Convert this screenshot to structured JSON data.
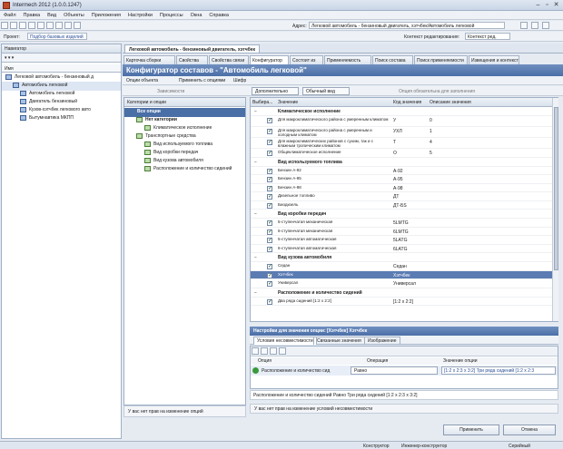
{
  "window": {
    "title": "Intermech 2012 (1.0.0.1247)"
  },
  "menu": [
    "Файл",
    "Правка",
    "Вид",
    "Объекты",
    "Приложения",
    "Настройки",
    "Процессы",
    "Окна",
    "Справка"
  ],
  "toolbar": {
    "address_label": "Адрес:",
    "address_value": "Легковой автомобиль - бензиновый двигатель, хэтчбек/Автомобиль легковой",
    "project_label": "Проект:",
    "project_value": "Подбор базовых изделий",
    "context_label": "Контекст редактирования:",
    "context_value": "Контекст ред."
  },
  "left": {
    "nav_label": "Навигатор",
    "col_name": "Имя",
    "tree": [
      {
        "label": "Легковой автомобиль - бензиновый д",
        "level": 0
      },
      {
        "label": "Автомобиль легковой",
        "level": 1
      },
      {
        "label": "Автомобиль легковой",
        "level": 2
      },
      {
        "label": "Двигатель бензиновый",
        "level": 2
      },
      {
        "label": "Кузов-хэтчбек легкового авто",
        "level": 2
      },
      {
        "label": "Бытумнавтика МКПП",
        "level": 2
      }
    ]
  },
  "doc_tab": "Легковой автомобиль - бензиновый двигатель, хэтчбек",
  "tabs": [
    "Карточка сборки",
    "Свойства",
    "Свойства связи",
    "Конфигуратор",
    "Состоит из",
    "Применяемость",
    "Поиск состава",
    "Поиск применяемости",
    "Извещения и контекст"
  ],
  "configurator": {
    "title": "Конфигуратор составов - \"Автомобиль легковой\"",
    "btn_objects": "Опции объекта",
    "btn_apply": "Применить с опциями",
    "btn_cipher": "Шифр",
    "btn_dependent": "Зависимости",
    "btn_additional": "Дополнительно",
    "btn_view": "Обычный вид",
    "mandatory_hint": "Опция обязательна для заполнения",
    "cat_header": "Категории и опции",
    "cat_tree": [
      {
        "label": "Все опции",
        "level": 0,
        "selected": true
      },
      {
        "label": "Нет категории",
        "level": 1,
        "bold": true
      },
      {
        "label": "Климатическое исполнение",
        "level": 2
      },
      {
        "label": "Транспортные средства",
        "level": 1
      },
      {
        "label": "Вид используемого топлива",
        "level": 2
      },
      {
        "label": "Вид коробки передач",
        "level": 2
      },
      {
        "label": "Вид кузова автомобиля",
        "level": 2
      },
      {
        "label": "Расположение и количество сидений",
        "level": 2
      }
    ],
    "grid_headers": [
      "Выбира...",
      "Значение",
      "Код значения",
      "Описание значения"
    ],
    "grid_rows": [
      {
        "type": "group",
        "value": "Климатическое исполнение"
      },
      {
        "type": "row",
        "checked": true,
        "value": "Для макроклиматического района с умеренным климатом",
        "code": "У",
        "desc": "0"
      },
      {
        "type": "row",
        "checked": true,
        "value": "Для макроклиматического района с умеренным и холодным климатом",
        "code": "УХЛ",
        "desc": "1"
      },
      {
        "type": "row",
        "checked": true,
        "value": "Для макроклиматических районов с сухим, так и с влажным тропическим климатом",
        "code": "Т",
        "desc": "4"
      },
      {
        "type": "row",
        "checked": true,
        "value": "Общеклиматическое исполнение",
        "code": "О",
        "desc": "5"
      },
      {
        "type": "group",
        "value": "Вид используемого топлива"
      },
      {
        "type": "row",
        "checked": true,
        "value": "Бензин А-92",
        "code": "А-92",
        "desc": ""
      },
      {
        "type": "row",
        "checked": true,
        "value": "Бензин А-95",
        "code": "А-95",
        "desc": ""
      },
      {
        "type": "row",
        "checked": true,
        "value": "Бензин А-98",
        "code": "А-98",
        "desc": ""
      },
      {
        "type": "row",
        "checked": true,
        "value": "Дизельное топливо",
        "code": "ДТ",
        "desc": ""
      },
      {
        "type": "row",
        "checked": true,
        "value": "Биодизель",
        "code": "ДТ-БS",
        "desc": ""
      },
      {
        "type": "group",
        "value": "Вид коробки передач"
      },
      {
        "type": "row",
        "checked": true,
        "value": "5-ступенчатая механическая",
        "code": "5LMTG",
        "desc": ""
      },
      {
        "type": "row",
        "checked": true,
        "value": "6-ступенчатая механическая",
        "code": "6LMTG",
        "desc": ""
      },
      {
        "type": "row",
        "checked": true,
        "value": "5-ступенчатая автоматическая",
        "code": "5LATG",
        "desc": ""
      },
      {
        "type": "row",
        "checked": true,
        "value": "6-ступенчатая автоматическая",
        "code": "6LATG",
        "desc": ""
      },
      {
        "type": "group",
        "value": "Вид кузова автомобиля"
      },
      {
        "type": "row",
        "checked": true,
        "value": "Седан",
        "code": "Седан",
        "desc": ""
      },
      {
        "type": "row",
        "checked": true,
        "value": "Хэтчбек",
        "code": "Хэтчбек",
        "desc": "",
        "selected": true
      },
      {
        "type": "row",
        "checked": true,
        "value": "Универсал",
        "code": "Универсал",
        "desc": ""
      },
      {
        "type": "group",
        "value": "Расположение и количество сидений"
      },
      {
        "type": "row",
        "checked": true,
        "value": "Два ряда сидений [1:2 х 2:2]",
        "code": "[1:2 х 2:2]",
        "desc": ""
      }
    ],
    "settings": {
      "title": "Настройки для значения опции: [Хэтчбек] Хэтчбек",
      "tabs": [
        "Условия несовместимости",
        "Связанные значения",
        "Изображение"
      ],
      "headers": [
        "Опция",
        "Операция",
        "Значение опции"
      ],
      "row": {
        "option": "Расположение и количество сид",
        "op": "Равно",
        "value": "[1:2 х 2:3 х 3:2] Три ряда сидений [1:2 х 2:3"
      },
      "formula": "Расположение и количество сидений Равно Три ряда сидений [1:2 х 2:3 х 3:2]",
      "hint": "У вас нет прав на изменение условий несовместимости"
    },
    "left_hint": "У вас нет прав на изменение опций",
    "btn_ok": "Применить",
    "btn_cancel": "Отмена"
  },
  "status": {
    "items": [
      "Конструктор",
      "Инженер-конструктор",
      "Серийный"
    ]
  }
}
